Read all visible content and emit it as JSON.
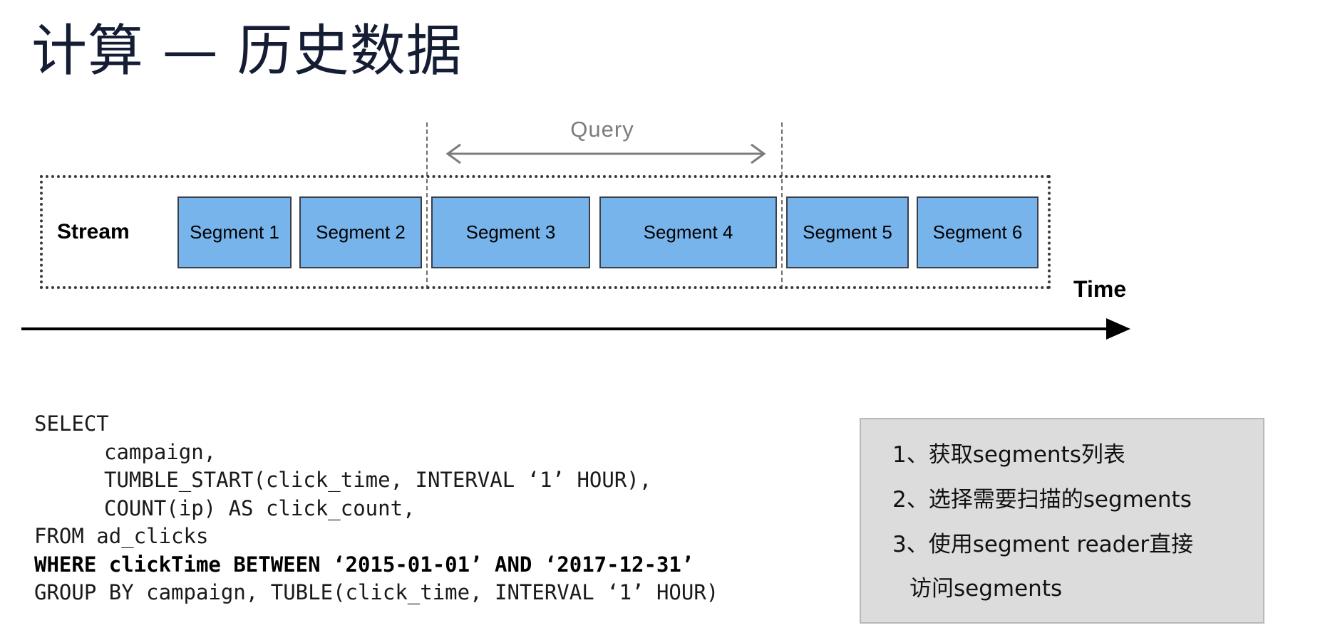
{
  "title": "计算 — 历史数据",
  "diagram": {
    "stream_label": "Stream",
    "time_label": "Time",
    "query_label": "Query",
    "segments": [
      "Segment 1",
      "Segment 2",
      "Segment 3",
      "Segment 4",
      "Segment 5",
      "Segment 6"
    ],
    "segment_color": "#78b4ec",
    "query_covers": [
      "Segment 3",
      "Segment 4"
    ]
  },
  "sql": {
    "lines": [
      "SELECT",
      "campaign,",
      "TUMBLE_START(click_time, INTERVAL ‘1’ HOUR),",
      "COUNT(ip) AS click_count,",
      "FROM ad_clicks",
      "WHERE clickTime BETWEEN ‘2015-01-01’ AND ‘2017-12-31’",
      "GROUP BY campaign, TUBLE(click_time, INTERVAL ‘1’ HOUR)"
    ]
  },
  "steps": [
    "1、获取segments列表",
    "2、选择需要扫描的segments",
    "3、使用segment reader直接",
    "访问segments"
  ]
}
